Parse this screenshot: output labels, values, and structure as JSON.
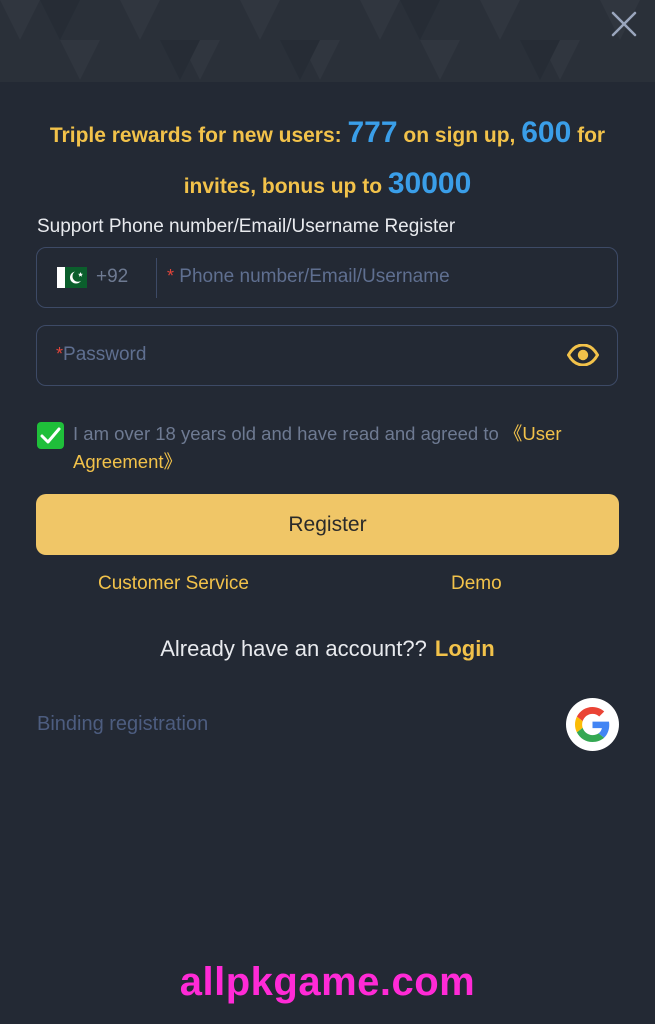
{
  "promo": {
    "part1": "Triple rewards for new users: ",
    "signup_amount": "777",
    "part2": " on sign up, ",
    "invite_amount": "600",
    "part3": " for invites, bonus up to ",
    "bonus_amount": "30000"
  },
  "support_label": "Support Phone number/Email/Username Register",
  "phone_field": {
    "country_code": "+92",
    "required_mark": "*",
    "placeholder": " Phone number/Email/Username"
  },
  "password_field": {
    "required_mark": "*",
    "placeholder": "Password"
  },
  "agreement": {
    "text": "I am over 18 years old and have read and agreed to ",
    "link": "《User Agreement》",
    "checked": true
  },
  "register_label": "Register",
  "customer_service_label": "Customer Service",
  "demo_label": "Demo",
  "login_prompt": {
    "text": "Already have an account??",
    "link": "Login"
  },
  "binding_label": "Binding registration",
  "watermark": "allpkgame.com",
  "colors": {
    "background": "#232934",
    "accent_gold": "#f2c24a",
    "accent_blue": "#3a9ee8",
    "button": "#f0c667",
    "checkbox": "#1fbf3a",
    "watermark": "#ff2ad6"
  },
  "icons": {
    "close": "close-icon",
    "flag": "pakistan-flag-icon",
    "eye": "eye-icon",
    "check": "checkmark-icon",
    "google": "google-icon"
  }
}
